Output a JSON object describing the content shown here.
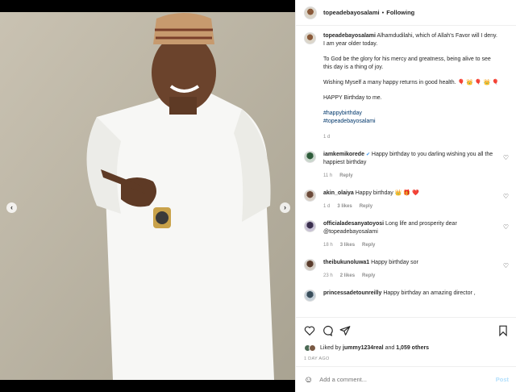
{
  "post": {
    "username": "topeadebayosalami",
    "separator": "•",
    "follow_label": "Following"
  },
  "caption": {
    "username": "topeadebayosalami",
    "line1": "Alhamdudilahi, which of Allah's Favor will I deny. I am year older today.",
    "line2": "To God be the glory for his mercy and greatness, being alive to see this day is a thing of joy.",
    "line3": "Wishing Myself a many happy returns in good health. 🎈 👑 🎈 👑 🎈",
    "line4": "HAPPY Birthday to me.",
    "tag1": "#happybirthday",
    "tag2": "#topeadebayosalami",
    "time": "1 d"
  },
  "comments": [
    {
      "username": "iamkemikorede",
      "verified": "✔",
      "text": "Happy birthday to you darling wishing you all the happiest birthday",
      "time": "11 h",
      "likes": "",
      "reply": "Reply"
    },
    {
      "username": "akin_olaiya",
      "verified": "",
      "text": "Happy birthday 👑 🎁 ❤️",
      "time": "1 d",
      "likes": "3 likes",
      "reply": "Reply"
    },
    {
      "username": "officialadesanyatoyosi",
      "verified": "",
      "text": "Long life and prosperity dear @topeadebayosalami",
      "time": "18 h",
      "likes": "3 likes",
      "reply": "Reply"
    },
    {
      "username": "theibukunoluwa1",
      "verified": "",
      "text": "Happy birthday sor",
      "time": "23 h",
      "likes": "2 likes",
      "reply": "Reply"
    },
    {
      "username": "princessadetounreilly",
      "verified": "",
      "text": "Happy birthday an amazing director ,",
      "time": "",
      "likes": "",
      "reply": ""
    }
  ],
  "likes": {
    "prefix": "Liked by",
    "user": "jummy1234real",
    "middle": "and",
    "others": "1,059 others"
  },
  "date": "1 DAY AGO",
  "add_comment": {
    "emoji": "☺",
    "placeholder": "Add a comment...",
    "post_label": "Post"
  },
  "nav": {
    "prev": "‹",
    "next": "›"
  },
  "colors": {
    "link": "#00376b",
    "verified": "#3897f0",
    "muted": "#8e8e8e"
  }
}
